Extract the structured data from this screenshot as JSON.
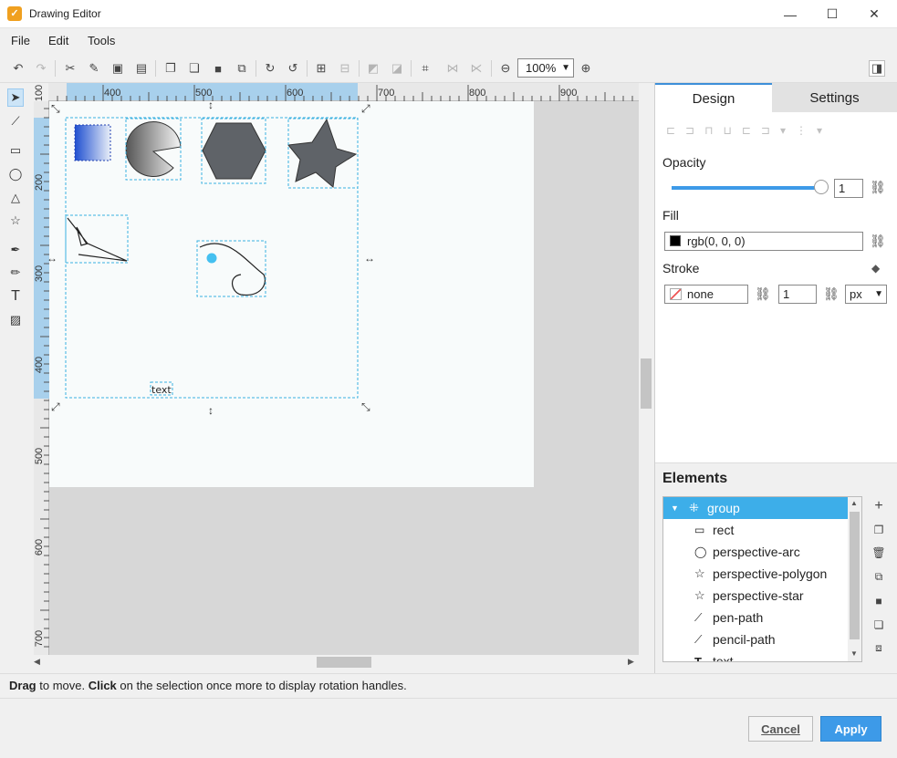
{
  "window": {
    "title": "Drawing Editor"
  },
  "menu": {
    "file": "File",
    "edit": "Edit",
    "tools": "Tools"
  },
  "toolbar": {
    "zoom": "100%"
  },
  "rulers": {
    "h_labels": [
      "400",
      "500",
      "600",
      "700",
      "800",
      "900"
    ],
    "v_labels": [
      "100",
      "200",
      "300",
      "400",
      "500",
      "600",
      "700"
    ]
  },
  "canvas": {
    "text_label": "text"
  },
  "panel": {
    "tabs": [
      "Design",
      "Settings"
    ],
    "opacity_label": "Opacity",
    "opacity_value": "1",
    "opacity_level": 1,
    "fill_label": "Fill",
    "fill_value": "rgb(0, 0, 0)",
    "fill_color": "#000000",
    "stroke_label": "Stroke",
    "stroke_value": "none",
    "stroke_width": "1",
    "stroke_unit": "px"
  },
  "elements": {
    "title": "Elements",
    "items": [
      {
        "label": "group",
        "icon": "group-icon"
      },
      {
        "label": "rect",
        "icon": "rect-icon"
      },
      {
        "label": "perspective-arc",
        "icon": "arc-icon"
      },
      {
        "label": "perspective-polygon",
        "icon": "polygon-icon"
      },
      {
        "label": "perspective-star",
        "icon": "star-icon"
      },
      {
        "label": "pen-path",
        "icon": "path-icon"
      },
      {
        "label": "pencil-path",
        "icon": "path-icon"
      },
      {
        "label": "text",
        "icon": "text-icon"
      }
    ]
  },
  "status": {
    "drag": "Drag",
    "mid": " to move. ",
    "click": "Click",
    "rest": " on the selection once more to display rotation handles."
  },
  "buttons": {
    "cancel": "Cancel",
    "apply": "Apply"
  },
  "colors": {
    "accent": "#3d9ae8",
    "selection": "#3ab0e0",
    "tree_selected": "#3daee9"
  }
}
